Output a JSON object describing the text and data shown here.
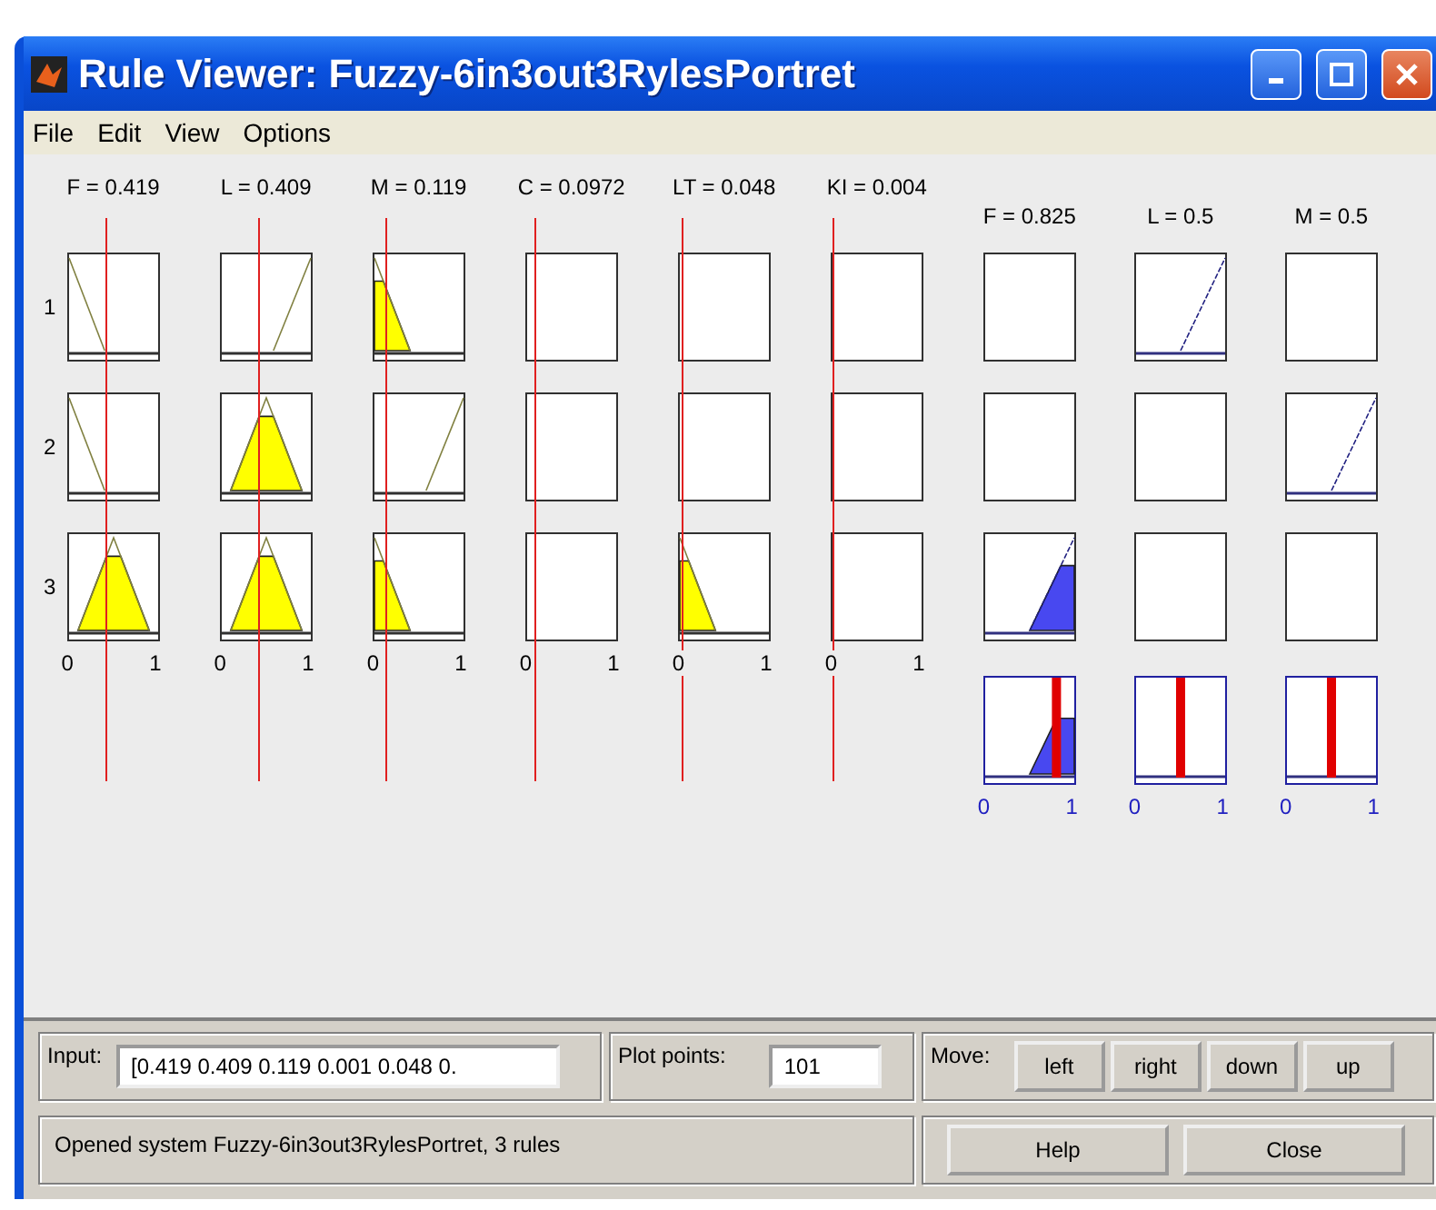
{
  "window": {
    "title": "Rule Viewer: Fuzzy-6in3out3RylesPortret"
  },
  "menu": [
    "File",
    "Edit",
    "View",
    "Options"
  ],
  "rule_numbers": [
    "1",
    "2",
    "3"
  ],
  "inputs": [
    {
      "label": "F = 0.419",
      "axis": [
        "0",
        "1"
      ],
      "rules": [
        {
          "kind": "down",
          "fired": false
        },
        {
          "kind": "down",
          "fired": false
        },
        {
          "kind": "peak",
          "fired": true
        }
      ]
    },
    {
      "label": "L = 0.409",
      "axis": [
        "0",
        "1"
      ],
      "rules": [
        {
          "kind": "up",
          "fired": false
        },
        {
          "kind": "peak",
          "fired": true
        },
        {
          "kind": "peak",
          "fired": true
        }
      ]
    },
    {
      "label": "M = 0.119",
      "axis": [
        "0",
        "1"
      ],
      "rules": [
        {
          "kind": "down",
          "fired": true
        },
        {
          "kind": "up",
          "fired": false
        },
        {
          "kind": "down",
          "fired": true
        }
      ]
    },
    {
      "label": "C = 0.0972",
      "axis": [
        "0",
        "1"
      ],
      "rules": [
        {
          "kind": "none"
        },
        {
          "kind": "none"
        },
        {
          "kind": "none"
        }
      ]
    },
    {
      "label": "LT = 0.048",
      "axis": [
        "0",
        "1"
      ],
      "rules": [
        {
          "kind": "none"
        },
        {
          "kind": "none"
        },
        {
          "kind": "down",
          "fired": true
        }
      ]
    },
    {
      "label": "KI = 0.004",
      "axis": [
        "0",
        "1"
      ],
      "rules": [
        {
          "kind": "none"
        },
        {
          "kind": "none"
        },
        {
          "kind": "none"
        }
      ]
    }
  ],
  "outputs": [
    {
      "label": "F = 0.825",
      "axis": [
        "0",
        "1"
      ],
      "rules": [
        {
          "kind": "none"
        },
        {
          "kind": "none"
        },
        {
          "kind": "up",
          "fired": true
        }
      ],
      "aggregate": {
        "kind": "up"
      }
    },
    {
      "label": "L = 0.5",
      "axis": [
        "0",
        "1"
      ],
      "rules": [
        {
          "kind": "up",
          "fired": false
        },
        {
          "kind": "none"
        },
        {
          "kind": "none"
        }
      ],
      "aggregate": {
        "kind": "none"
      }
    },
    {
      "label": "M = 0.5",
      "axis": [
        "0",
        "1"
      ],
      "rules": [
        {
          "kind": "none"
        },
        {
          "kind": "up",
          "fired": false
        },
        {
          "kind": "none"
        }
      ],
      "aggregate": {
        "kind": "none"
      }
    }
  ],
  "input_field": {
    "label": "Input:",
    "value": "[0.419 0.409 0.119 0.001 0.048 0."
  },
  "plot_points": {
    "label": "Plot points:",
    "value": "101"
  },
  "move": {
    "label": "Move:",
    "buttons": [
      "left",
      "right",
      "down",
      "up"
    ]
  },
  "status": "Opened system Fuzzy-6in3out3RylesPortret, 3 rules",
  "buttons": [
    "Help",
    "Close"
  ]
}
